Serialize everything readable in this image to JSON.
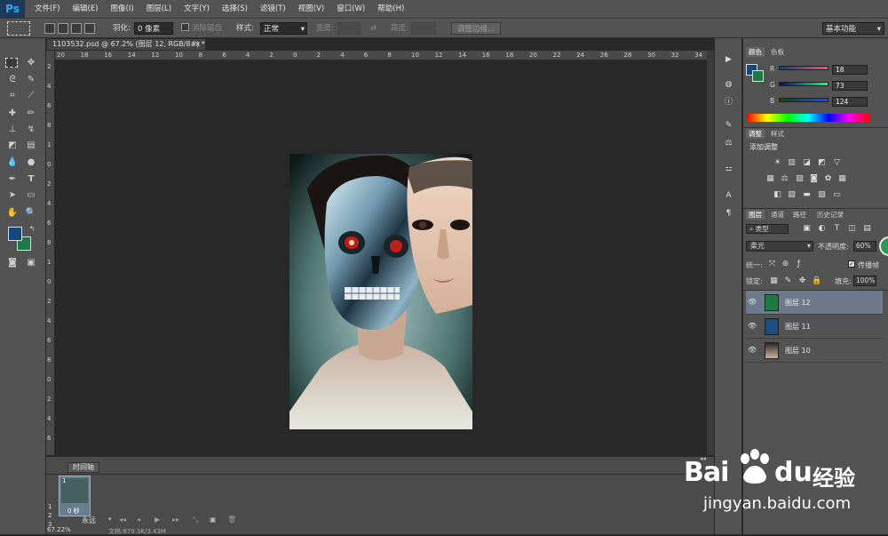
{
  "app": {
    "logo": "Ps"
  },
  "menu": [
    "文件(F)",
    "编辑(E)",
    "图像(I)",
    "图层(L)",
    "文字(Y)",
    "选择(S)",
    "滤镜(T)",
    "视图(V)",
    "窗口(W)",
    "帮助(H)"
  ],
  "options": {
    "feather_label": "羽化:",
    "feather_value": "0 像素",
    "antialias_label": "消除锯齿",
    "style_label": "样式:",
    "style_value": "正常",
    "width_label": "宽度:",
    "height_label": "高度:",
    "refine_edge": "调整边缘...",
    "workspace": "基本功能"
  },
  "document": {
    "tab_title": "1103532.psd @ 67.2% (图层 12, RGB/8#) *",
    "close": "×",
    "zoom": "67.22%",
    "doc_info": "文档:879.3K/3.43M"
  },
  "rulers": {
    "h": [
      "20",
      "18",
      "16",
      "14",
      "12",
      "10",
      "8",
      "6",
      "4",
      "2",
      "0",
      "2",
      "4",
      "6",
      "8",
      "10",
      "12",
      "14",
      "16",
      "18",
      "20",
      "22",
      "24",
      "26",
      "28",
      "30",
      "32",
      "34"
    ],
    "v": [
      "2",
      "4",
      "6",
      "8",
      "1",
      "0",
      "2",
      "4",
      "6",
      "8",
      "1",
      "0",
      "2",
      "4",
      "6",
      "8",
      "0",
      "2",
      "4",
      "6"
    ]
  },
  "timeline": {
    "tab": "时间轴",
    "frame_index": "1",
    "frame_delay": "0 秒",
    "loop": "永远",
    "frame_numbers": [
      "1",
      "2",
      "3"
    ]
  },
  "color_panel": {
    "tabs": [
      "颜色",
      "色板"
    ],
    "r_label": "R",
    "g_label": "G",
    "b_label": "B",
    "r": "18",
    "g": "73",
    "b": "124",
    "foreground_color": "#12497c"
  },
  "adjustments_panel": {
    "tabs": [
      "调整",
      "样式"
    ],
    "title": "添加调整"
  },
  "layers_panel": {
    "tabs": [
      "图层",
      "通道",
      "路径",
      "历史记录"
    ],
    "filter": "类型",
    "blend_mode": "柔光",
    "opacity_label": "不透明度:",
    "opacity": "60%",
    "unify_label": "统一:",
    "propagate_label": "传播帧",
    "lock_label": "锁定:",
    "fill_label": "填充:",
    "fill": "100%",
    "layers": [
      {
        "name": "图层 12",
        "color": "#1e7a45",
        "selected": true
      },
      {
        "name": "图层 11",
        "color": "#1a4d80",
        "selected": false
      },
      {
        "name": "图层 10",
        "color": "photo",
        "selected": false
      }
    ]
  },
  "watermark": {
    "brand": "Bai",
    "brand2": "du",
    "cn": "经验",
    "url": "jingyan.baidu.com"
  }
}
